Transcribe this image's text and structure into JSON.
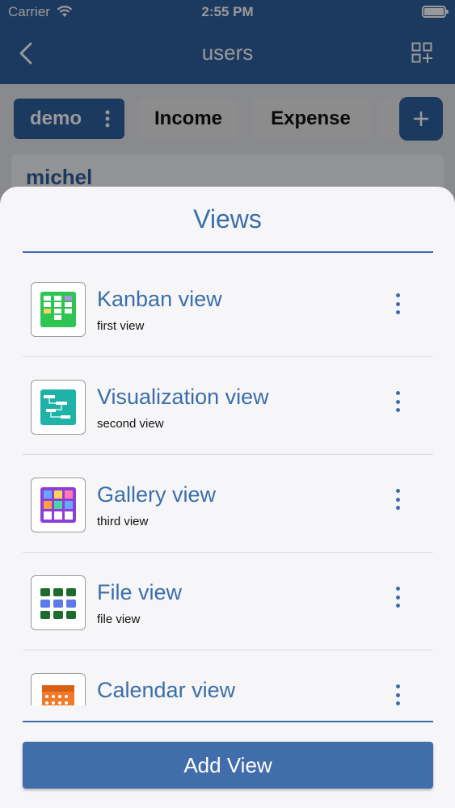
{
  "status_bar": {
    "carrier": "Carrier",
    "time": "2:55 PM"
  },
  "nav": {
    "title": "users"
  },
  "tabs": [
    {
      "label": "demo"
    },
    {
      "label": "Income"
    },
    {
      "label": "Expense"
    }
  ],
  "record": {
    "name": "michel"
  },
  "sheet": {
    "title": "Views",
    "items": [
      {
        "name": "Kanban view",
        "description": "first view",
        "icon": "kanban-icon"
      },
      {
        "name": "Visualization view",
        "description": "second view",
        "icon": "visualization-icon"
      },
      {
        "name": "Gallery view",
        "description": "third view",
        "icon": "gallery-icon"
      },
      {
        "name": "File view",
        "description": "file view",
        "icon": "file-grid-icon"
      },
      {
        "name": "Calendar view",
        "description": "",
        "icon": "calendar-icon"
      }
    ],
    "add_button_label": "Add View"
  },
  "colors": {
    "primary": "#2f5fa0",
    "accent": "#3b6ea9",
    "button": "#416eaa"
  }
}
